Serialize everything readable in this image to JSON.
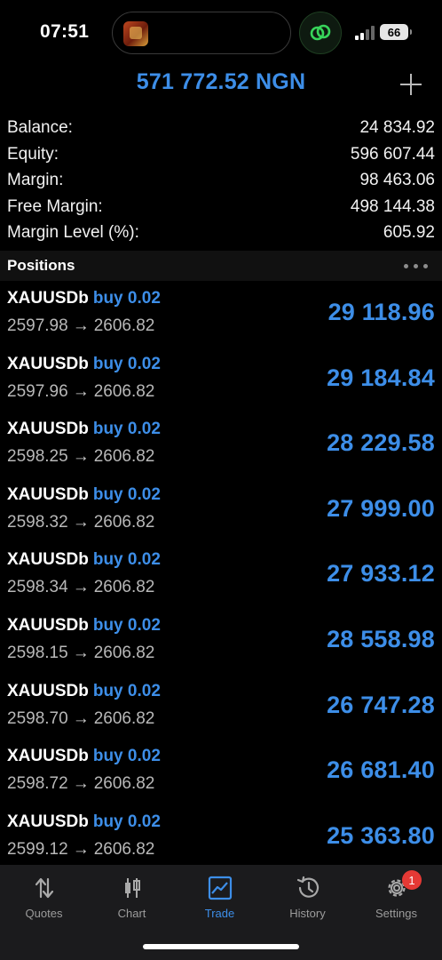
{
  "status_bar": {
    "time": "07:51",
    "battery": "66",
    "accent": "#3d8ee8"
  },
  "header": {
    "balance_total": "571 772.52 NGN",
    "add_icon": "plus-icon"
  },
  "account": [
    {
      "label": "Balance:",
      "value": "24 834.92"
    },
    {
      "label": "Equity:",
      "value": "596 607.44"
    },
    {
      "label": "Margin:",
      "value": "98 463.06"
    },
    {
      "label": "Free Margin:",
      "value": "498 144.38"
    },
    {
      "label": "Margin Level (%):",
      "value": "605.92"
    }
  ],
  "positions": {
    "title": "Positions",
    "items": [
      {
        "symbol": "XAUUSDb",
        "type": "buy 0.02",
        "open": "2597.98",
        "arrow": "→",
        "current": "2606.82",
        "profit": "29 118.96"
      },
      {
        "symbol": "XAUUSDb",
        "type": "buy 0.02",
        "open": "2597.96",
        "arrow": "→",
        "current": "2606.82",
        "profit": "29 184.84"
      },
      {
        "symbol": "XAUUSDb",
        "type": "buy 0.02",
        "open": "2598.25",
        "arrow": "→",
        "current": "2606.82",
        "profit": "28 229.58"
      },
      {
        "symbol": "XAUUSDb",
        "type": "buy 0.02",
        "open": "2598.32",
        "arrow": "→",
        "current": "2606.82",
        "profit": "27 999.00"
      },
      {
        "symbol": "XAUUSDb",
        "type": "buy 0.02",
        "open": "2598.34",
        "arrow": "→",
        "current": "2606.82",
        "profit": "27 933.12"
      },
      {
        "symbol": "XAUUSDb",
        "type": "buy 0.02",
        "open": "2598.15",
        "arrow": "→",
        "current": "2606.82",
        "profit": "28 558.98"
      },
      {
        "symbol": "XAUUSDb",
        "type": "buy 0.02",
        "open": "2598.70",
        "arrow": "→",
        "current": "2606.82",
        "profit": "26 747.28"
      },
      {
        "symbol": "XAUUSDb",
        "type": "buy 0.02",
        "open": "2598.72",
        "arrow": "→",
        "current": "2606.82",
        "profit": "26 681.40"
      },
      {
        "symbol": "XAUUSDb",
        "type": "buy 0.02",
        "open": "2599.12",
        "arrow": "→",
        "current": "2606.82",
        "profit": "25 363.80"
      }
    ]
  },
  "tabs": [
    {
      "label": "Quotes",
      "icon": "quotes-icon",
      "active": false
    },
    {
      "label": "Chart",
      "icon": "chart-icon",
      "active": false
    },
    {
      "label": "Trade",
      "icon": "trade-icon",
      "active": true
    },
    {
      "label": "History",
      "icon": "history-icon",
      "active": false
    },
    {
      "label": "Settings",
      "icon": "settings-icon",
      "active": false,
      "badge": "1"
    }
  ]
}
